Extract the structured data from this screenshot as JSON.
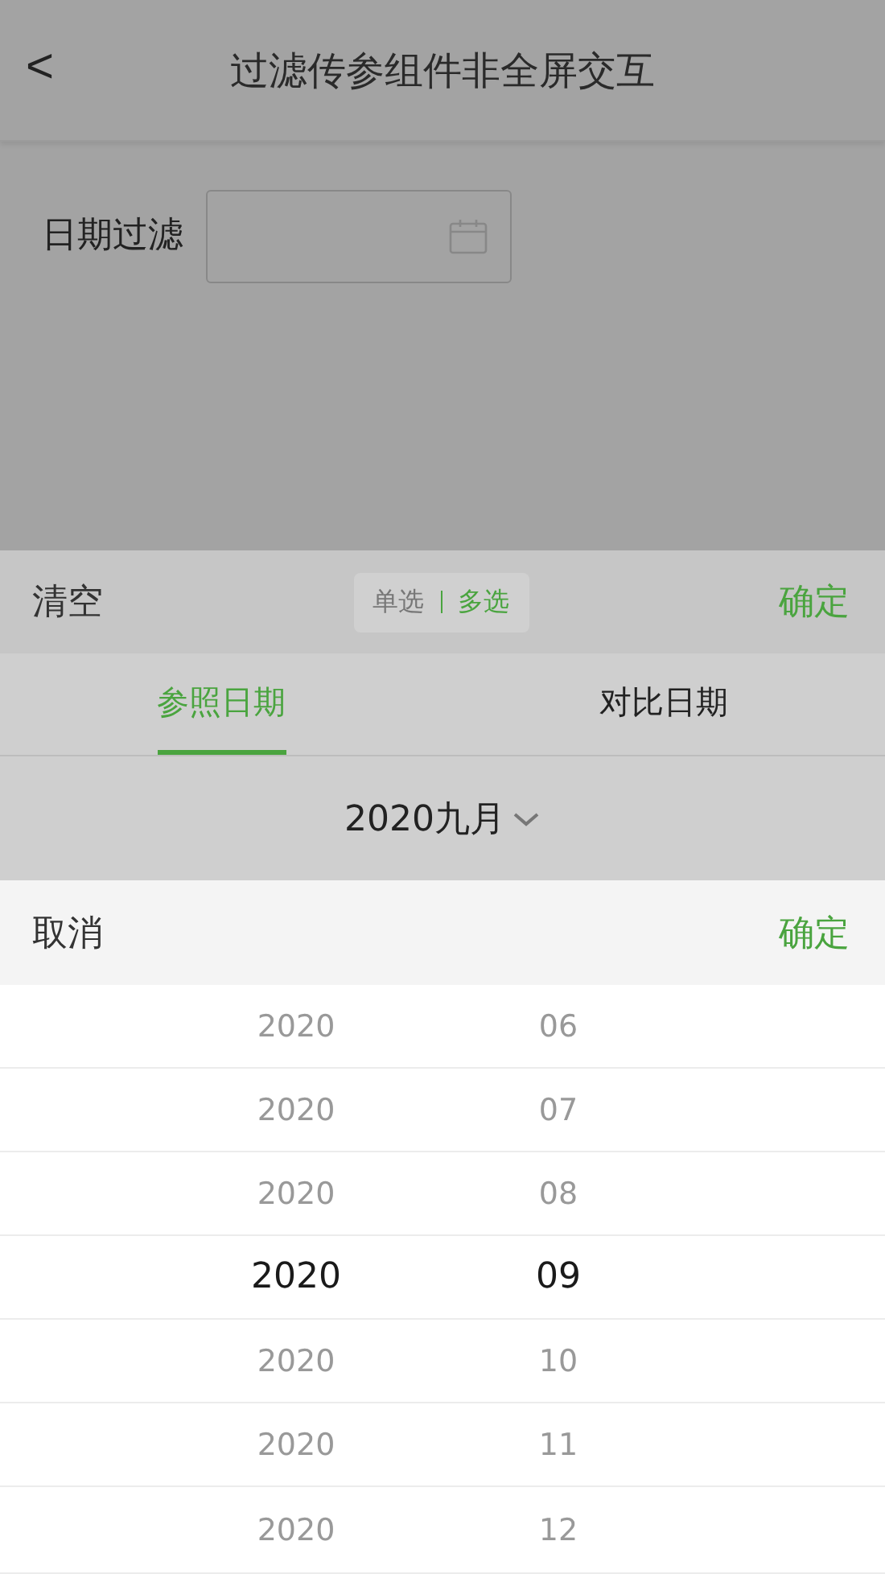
{
  "header": {
    "back": "<",
    "title": "过滤传参组件非全屏交互"
  },
  "filter": {
    "label": "日期过滤"
  },
  "toolbar": {
    "clear": "清空",
    "modes": [
      {
        "label": "单选",
        "selected": false
      },
      {
        "label": "多选",
        "selected": true
      }
    ],
    "confirm": "确定"
  },
  "tabs": [
    {
      "label": "参照日期",
      "selected": true
    },
    {
      "label": "对比日期",
      "selected": false
    }
  ],
  "month": "2020九月",
  "picker": {
    "cancel": "取消",
    "confirm": "确定",
    "rows": [
      {
        "year": "2020",
        "month": "06",
        "selected": false
      },
      {
        "year": "2020",
        "month": "07",
        "selected": false
      },
      {
        "year": "2020",
        "month": "08",
        "selected": false
      },
      {
        "year": "2020",
        "month": "09",
        "selected": true
      },
      {
        "year": "2020",
        "month": "10",
        "selected": false
      },
      {
        "year": "2020",
        "month": "11",
        "selected": false
      },
      {
        "year": "2020",
        "month": "12",
        "selected": false
      }
    ]
  }
}
